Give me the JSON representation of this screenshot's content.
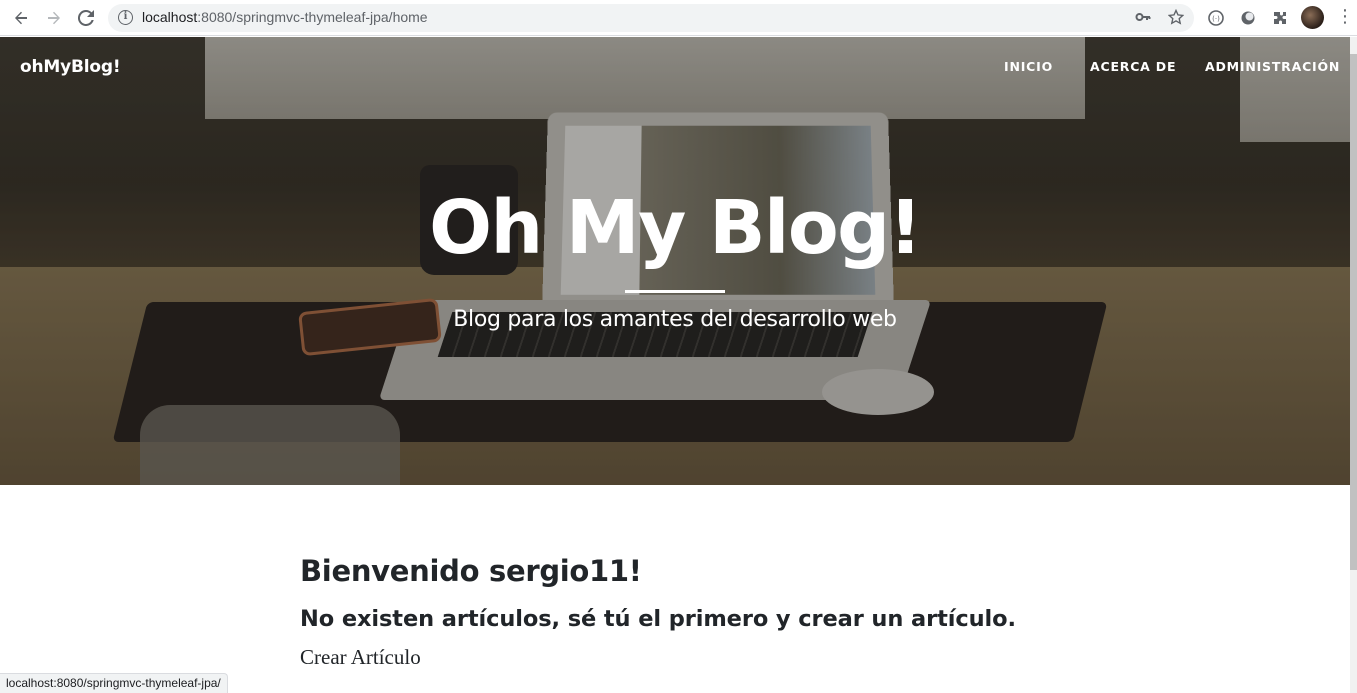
{
  "browser": {
    "url_host": "localhost",
    "url_rest": ":8080/springmvc-thymeleaf-jpa/home",
    "status_url": "localhost:8080/springmvc-thymeleaf-jpa/"
  },
  "navbar": {
    "brand": "ohMyBlog!",
    "items": [
      {
        "label": "INICIO"
      },
      {
        "label": "ACERCA DE"
      },
      {
        "label": "ADMINISTRACIÓN"
      }
    ]
  },
  "hero": {
    "title": "Oh My Blog!",
    "subtitle": "Blog para los amantes del desarrollo web"
  },
  "main": {
    "welcome": "Bienvenido sergio11!",
    "empty_message": "No existen artículos, sé tú el primero y crear un artículo.",
    "create_link": "Crear Artículo"
  },
  "icons": [
    "back-icon",
    "forward-icon",
    "reload-icon",
    "info-icon",
    "key-icon",
    "star-icon",
    "extension-icon",
    "menu-icon"
  ]
}
